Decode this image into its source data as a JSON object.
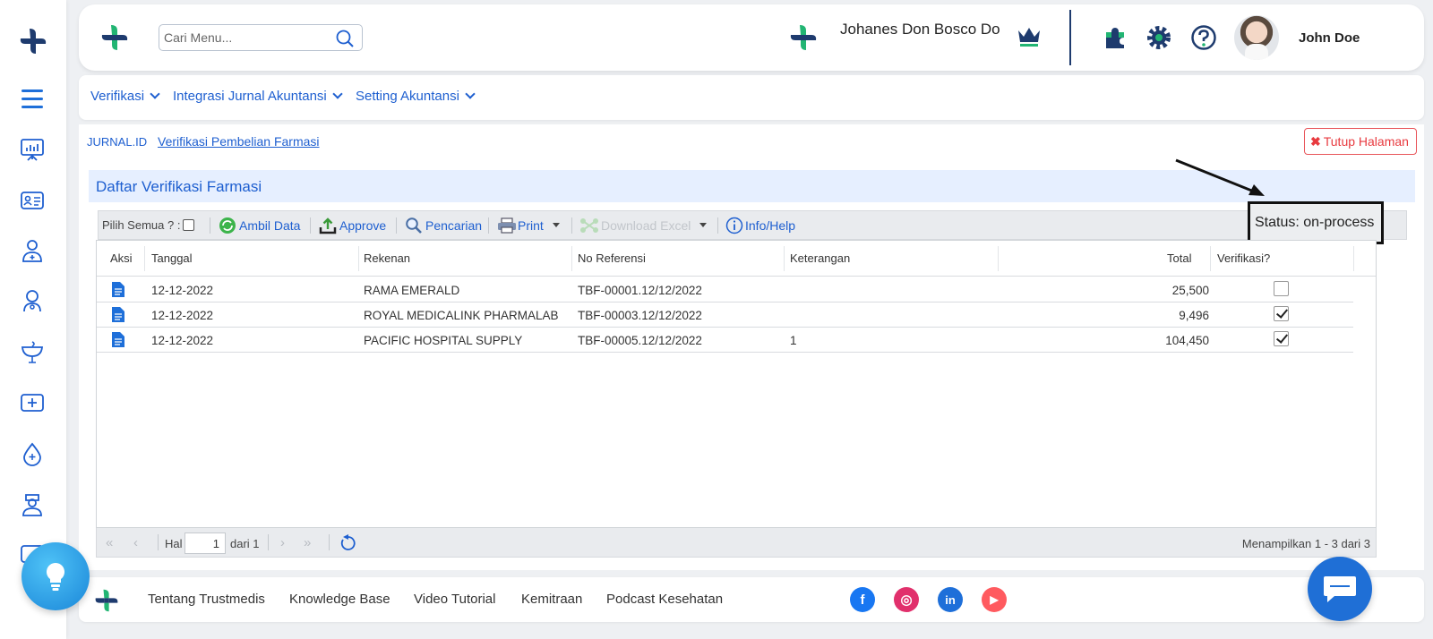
{
  "header": {
    "search_placeholder": "Cari Menu...",
    "org_name": "Johanes Don Bosco Do",
    "user_name": "John Doe"
  },
  "menu": {
    "items": [
      {
        "label": "Verifikasi"
      },
      {
        "label": "Integrasi Jurnal Akuntansi"
      },
      {
        "label": "Setting Akuntansi"
      }
    ]
  },
  "breadcrumb": {
    "root": "JURNAL.ID",
    "current": "Verifikasi Pembelian Farmasi"
  },
  "close_page_label": "Tutup Halaman",
  "panel": {
    "title": "Daftar Verifikasi Farmasi"
  },
  "toolbar": {
    "select_all_label": "Pilih Semua ? :",
    "fetch_label": "Ambil Data",
    "approve_label": "Approve",
    "search_label": "Pencarian",
    "print_label": "Print",
    "download_label": "Download Excel",
    "info_label": "Info/Help",
    "status_label": "Status: on-process"
  },
  "table": {
    "columns": {
      "aksi": "Aksi",
      "tanggal": "Tanggal",
      "rekenan": "Rekenan",
      "no_referensi": "No Referensi",
      "keterangan": "Keterangan",
      "total": "Total",
      "verifikasi": "Verifikasi?"
    },
    "rows": [
      {
        "tanggal": "12-12-2022",
        "rekenan": "RAMA EMERALD",
        "no_referensi": "TBF-00001.12/12/2022",
        "keterangan": "",
        "total": "25,500",
        "verified": false
      },
      {
        "tanggal": "12-12-2022",
        "rekenan": "ROYAL MEDICALINK PHARMALAB",
        "no_referensi": "TBF-00003.12/12/2022",
        "keterangan": "",
        "total": "9,496",
        "verified": true
      },
      {
        "tanggal": "12-12-2022",
        "rekenan": "PACIFIC HOSPITAL SUPPLY",
        "no_referensi": "TBF-00005.12/12/2022",
        "keterangan": "1",
        "total": "104,450",
        "verified": true
      }
    ]
  },
  "pager": {
    "page_label": "Hal",
    "page_value": "1",
    "of_label": "dari 1",
    "info": "Menampilkan 1 - 3 dari 3"
  },
  "footer": {
    "links": [
      "Tentang Trustmedis",
      "Knowledge Base",
      "Video Tutorial",
      "Kemitraan",
      "Podcast Kesehatan"
    ],
    "social": [
      {
        "name": "facebook-icon",
        "glyph": "f",
        "color": "#1877f2"
      },
      {
        "name": "instagram-icon",
        "glyph": "◎",
        "color": "#e1306c"
      },
      {
        "name": "linkedin-icon",
        "glyph": "in",
        "color": "#1e6fd9"
      },
      {
        "name": "youtube-icon",
        "glyph": "▶",
        "color": "#ff5a5f"
      }
    ]
  },
  "colors": {
    "brand_blue": "#1e5fd0",
    "brand_green": "#22b573",
    "brand_navy": "#1e3b6e",
    "danger": "#e83a3f"
  }
}
